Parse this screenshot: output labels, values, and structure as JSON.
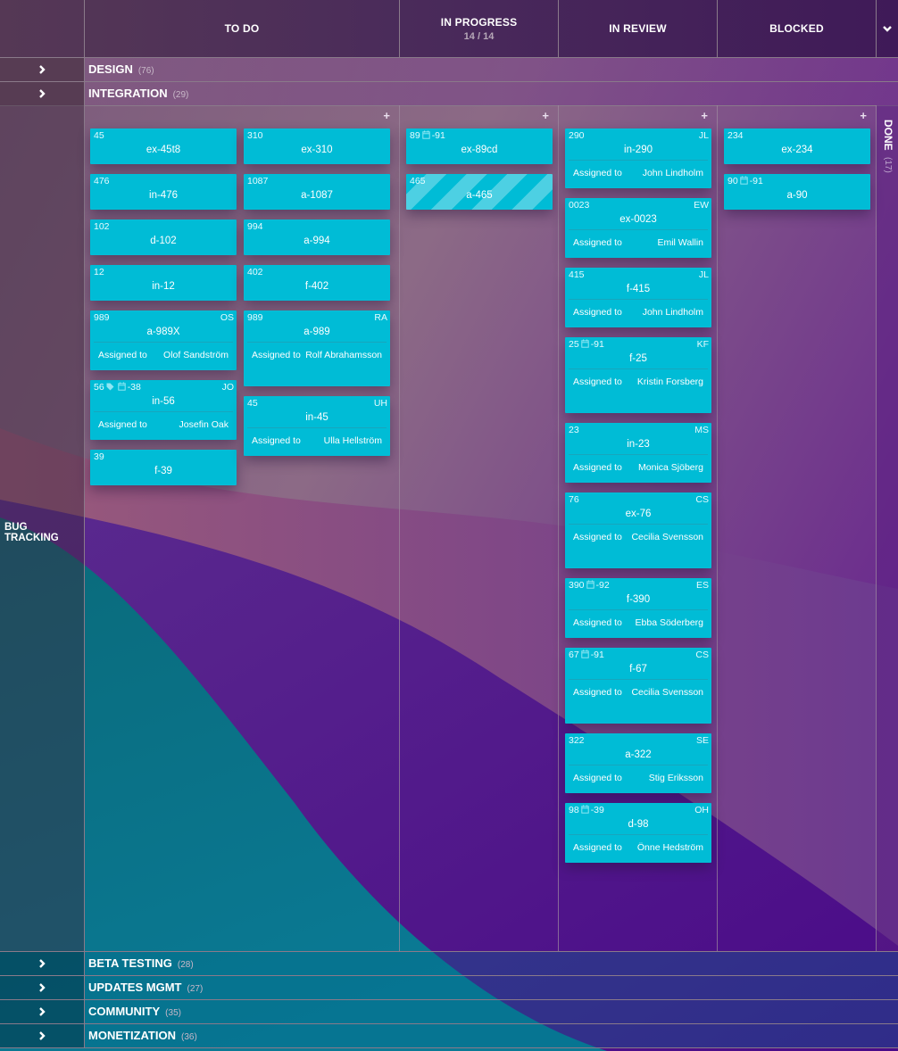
{
  "header": {
    "columns": [
      {
        "title": "TO DO",
        "sub": ""
      },
      {
        "title": "IN PROGRESS",
        "sub": "14 / 14"
      },
      {
        "title": "IN REVIEW",
        "sub": ""
      },
      {
        "title": "BLOCKED",
        "sub": ""
      }
    ],
    "collapse_icon": "chevron-down-icon"
  },
  "lanes_top": [
    {
      "label": "DESIGN",
      "count": "(76)"
    },
    {
      "label": "INTEGRATION",
      "count": "(29)"
    }
  ],
  "expanded_lane": {
    "label": "BUG TRACKING",
    "add_label": "+",
    "done": {
      "label": "DONE",
      "count": "(17)"
    },
    "assigned_label": "Assigned to",
    "todo_left": [
      {
        "id": "45",
        "key": "ex-45t8"
      },
      {
        "id": "476",
        "key": "in-476"
      },
      {
        "id": "102",
        "key": "d-102"
      },
      {
        "id": "12",
        "key": "in-12"
      },
      {
        "id": "989",
        "key": "a-989X",
        "initials": "OS",
        "assignee": "Olof Sandström"
      },
      {
        "id": "56",
        "tag": true,
        "date": "-38",
        "key": "in-56",
        "initials": "JO",
        "assignee": "Josefin Oak"
      },
      {
        "id": "39",
        "key": "f-39"
      }
    ],
    "todo_right": [
      {
        "id": "310",
        "key": "ex-310"
      },
      {
        "id": "1087",
        "key": "a-1087"
      },
      {
        "id": "994",
        "key": "a-994"
      },
      {
        "id": "402",
        "key": "f-402"
      },
      {
        "id": "989",
        "key": "a-989",
        "initials": "RA",
        "assignee": "Rolf Abrahamsson"
      },
      {
        "id": "45",
        "key": "in-45",
        "initials": "UH",
        "assignee": "Ulla Hellström"
      }
    ],
    "in_progress": [
      {
        "id": "89",
        "date": "-91",
        "key": "ex-89cd"
      },
      {
        "id": "465",
        "key": "a-465",
        "striped": true
      }
    ],
    "in_review": [
      {
        "id": "290",
        "key": "in-290",
        "initials": "JL",
        "assignee": "John Lindholm"
      },
      {
        "id": "0023",
        "key": "ex-0023",
        "initials": "EW",
        "assignee": "Emil Wallin"
      },
      {
        "id": "415",
        "key": "f-415",
        "initials": "JL",
        "assignee": "John Lindholm"
      },
      {
        "id": "25",
        "date": "-91",
        "key": "f-25",
        "initials": "KF",
        "assignee": "Kristin Forsberg"
      },
      {
        "id": "23",
        "key": "in-23",
        "initials": "MS",
        "assignee": "Monica Sjöberg"
      },
      {
        "id": "76",
        "key": "ex-76",
        "initials": "CS",
        "assignee": "Cecilia Svensson"
      },
      {
        "id": "390",
        "date": "-92",
        "key": "f-390",
        "initials": "ES",
        "assignee": "Ebba Söderberg"
      },
      {
        "id": "67",
        "date": "-91",
        "key": "f-67",
        "initials": "CS",
        "assignee": "Cecilia Svensson"
      },
      {
        "id": "322",
        "key": "a-322",
        "initials": "SE",
        "assignee": "Stig Eriksson"
      },
      {
        "id": "98",
        "date": "-39",
        "key": "d-98",
        "initials": "OH",
        "assignee": "Önne Hedström"
      }
    ],
    "blocked": [
      {
        "id": "234",
        "key": "ex-234"
      },
      {
        "id": "90",
        "date": "-91",
        "key": "a-90"
      }
    ]
  },
  "lanes_bottom": [
    {
      "label": "BETA TESTING",
      "count": "(28)"
    },
    {
      "label": "UPDATES MGMT",
      "count": "(27)"
    },
    {
      "label": "COMMUNITY",
      "count": "(35)"
    },
    {
      "label": "MONETIZATION",
      "count": "(36)"
    }
  ],
  "colors": {
    "card": "#00bcd6",
    "card_stripe": "#4dd0e3"
  }
}
